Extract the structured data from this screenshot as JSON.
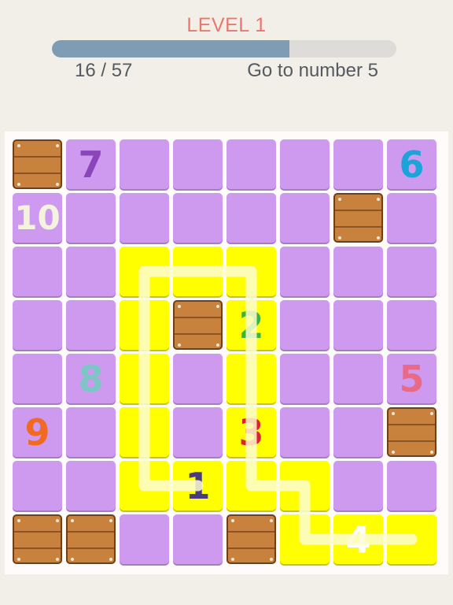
{
  "header": {
    "level_label": "LEVEL 1",
    "progress_text": "16 / 57",
    "progress_fraction": 0.69,
    "goal_text": "Go to number 5"
  },
  "board": {
    "rows": 8,
    "cols": 8,
    "cells": [
      [
        {
          "t": "wood"
        },
        {
          "t": "purple",
          "n": "7",
          "c": "#8a45b8"
        },
        {
          "t": "purple"
        },
        {
          "t": "purple"
        },
        {
          "t": "purple"
        },
        {
          "t": "purple"
        },
        {
          "t": "purple"
        },
        {
          "t": "purple",
          "n": "6",
          "c": "#1aa4d8"
        }
      ],
      [
        {
          "t": "purple",
          "n": "10",
          "c": "#f4f4de"
        },
        {
          "t": "purple"
        },
        {
          "t": "purple"
        },
        {
          "t": "purple"
        },
        {
          "t": "purple"
        },
        {
          "t": "purple"
        },
        {
          "t": "wood"
        },
        {
          "t": "purple"
        }
      ],
      [
        {
          "t": "purple"
        },
        {
          "t": "purple"
        },
        {
          "t": "yellow"
        },
        {
          "t": "yellow"
        },
        {
          "t": "yellow"
        },
        {
          "t": "purple"
        },
        {
          "t": "purple"
        },
        {
          "t": "purple"
        }
      ],
      [
        {
          "t": "purple"
        },
        {
          "t": "purple"
        },
        {
          "t": "yellow"
        },
        {
          "t": "wood"
        },
        {
          "t": "yellow",
          "n": "2",
          "c": "#3cb43c"
        },
        {
          "t": "purple"
        },
        {
          "t": "purple"
        },
        {
          "t": "purple"
        }
      ],
      [
        {
          "t": "purple"
        },
        {
          "t": "purple",
          "n": "8",
          "c": "#7cc6c6"
        },
        {
          "t": "yellow"
        },
        {
          "t": "purple"
        },
        {
          "t": "yellow"
        },
        {
          "t": "purple"
        },
        {
          "t": "purple"
        },
        {
          "t": "purple",
          "n": "5",
          "c": "#e86a86"
        }
      ],
      [
        {
          "t": "purple",
          "n": "9",
          "c": "#f06a22"
        },
        {
          "t": "purple"
        },
        {
          "t": "yellow"
        },
        {
          "t": "purple"
        },
        {
          "t": "yellow",
          "n": "3",
          "c": "#e0202a"
        },
        {
          "t": "purple"
        },
        {
          "t": "purple"
        },
        {
          "t": "wood"
        }
      ],
      [
        {
          "t": "purple"
        },
        {
          "t": "purple"
        },
        {
          "t": "yellow"
        },
        {
          "t": "yellow",
          "n": "1",
          "c": "#4b3c82"
        },
        {
          "t": "yellow"
        },
        {
          "t": "yellow"
        },
        {
          "t": "purple"
        },
        {
          "t": "purple"
        }
      ],
      [
        {
          "t": "wood"
        },
        {
          "t": "wood"
        },
        {
          "t": "purple"
        },
        {
          "t": "purple"
        },
        {
          "t": "wood"
        },
        {
          "t": "yellow"
        },
        {
          "t": "yellow",
          "n": "4",
          "c": "#ffffff"
        },
        {
          "t": "yellow"
        }
      ]
    ],
    "trail_cells": [
      [
        6,
        3
      ],
      [
        6,
        2
      ],
      [
        5,
        2
      ],
      [
        4,
        2
      ],
      [
        3,
        2
      ],
      [
        2,
        2
      ],
      [
        2,
        3
      ],
      [
        2,
        4
      ],
      [
        3,
        4
      ],
      [
        4,
        4
      ],
      [
        5,
        4
      ],
      [
        6,
        4
      ],
      [
        6,
        5
      ],
      [
        7,
        5
      ],
      [
        7,
        6
      ],
      [
        7,
        7
      ]
    ],
    "trail_color": "#fbfbd2"
  }
}
